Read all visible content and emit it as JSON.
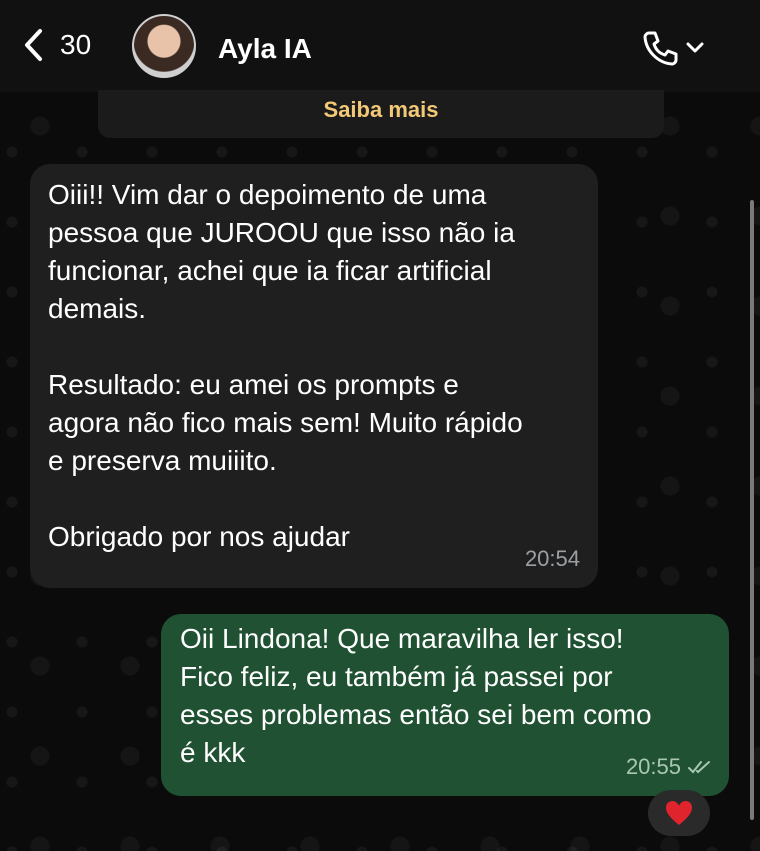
{
  "header": {
    "back_count": "30",
    "contact_name": "Ayla IA"
  },
  "info_banner": {
    "label": "Saiba mais",
    "color": "#f3c877"
  },
  "messages": [
    {
      "direction": "incoming",
      "text": "Oiii!! Vim dar o depoimento de uma\npessoa que JUROOU que isso não ia\nfuncionar, achei que ia ficar artificial\ndemais.\n\nResultado: eu amei os prompts e\nagora não fico mais sem! Muito rápido\ne preserva muiiito.\n\nObrigado por nos ajudar",
      "time": "20:54"
    },
    {
      "direction": "outgoing",
      "text": "Oii Lindona! Que maravilha ler isso!\nFico feliz, eu também já passei por\nesses problemas então sei bem como\né kkk",
      "time": "20:55",
      "status_icon": "double-check-icon",
      "reaction": "❤️"
    }
  ],
  "icons": {
    "back": "chevron-left-icon",
    "call": "phone-icon",
    "call_menu": "chevron-down-icon"
  },
  "colors": {
    "incoming_bubble": "#1f1f1f",
    "outgoing_bubble": "#1f5132",
    "header": "#111111"
  }
}
